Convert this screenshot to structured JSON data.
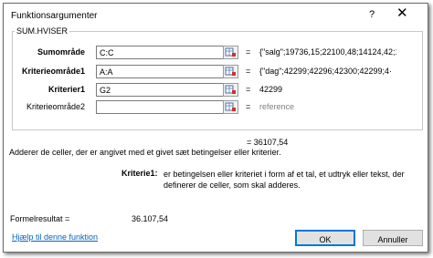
{
  "window": {
    "title": "Funktionsargumenter",
    "help_glyph": "?",
    "close_glyph": "✕"
  },
  "function_name": "SUM.HVISER",
  "arguments": [
    {
      "label": "Sumområde",
      "value": "C:C",
      "result": "{\"salg\";19736,15;22100,48;14124,42;1·"
    },
    {
      "label": "Kriterieområde1",
      "value": "A:A",
      "result": "{\"dag\";42299;42296;42300;42299;4·"
    },
    {
      "label": "Kriterier1",
      "value": "G2",
      "result": "42299"
    },
    {
      "label": "Kriterieområde2",
      "value": "",
      "result": "reference"
    }
  ],
  "equals": "=",
  "formula_value": "= 36107,54",
  "description": "Adderer de celler, der er angivet med et givet sæt betingelser eller kriterier.",
  "arg_help": {
    "label": "Kriterie1:",
    "text": "er betingelsen eller kriteriet i form af et tal, et udtryk eller tekst, der definerer de celler, som skal  adderes."
  },
  "formula_result": {
    "label": "Formelresultat =",
    "value": "36.107,54"
  },
  "help_link": "Hjælp til denne funktion",
  "buttons": {
    "ok": "OK",
    "cancel": "Annuller"
  },
  "colors": {
    "link": "#0563c1",
    "ok_border": "#0078d7",
    "gray_text": "#808080"
  }
}
